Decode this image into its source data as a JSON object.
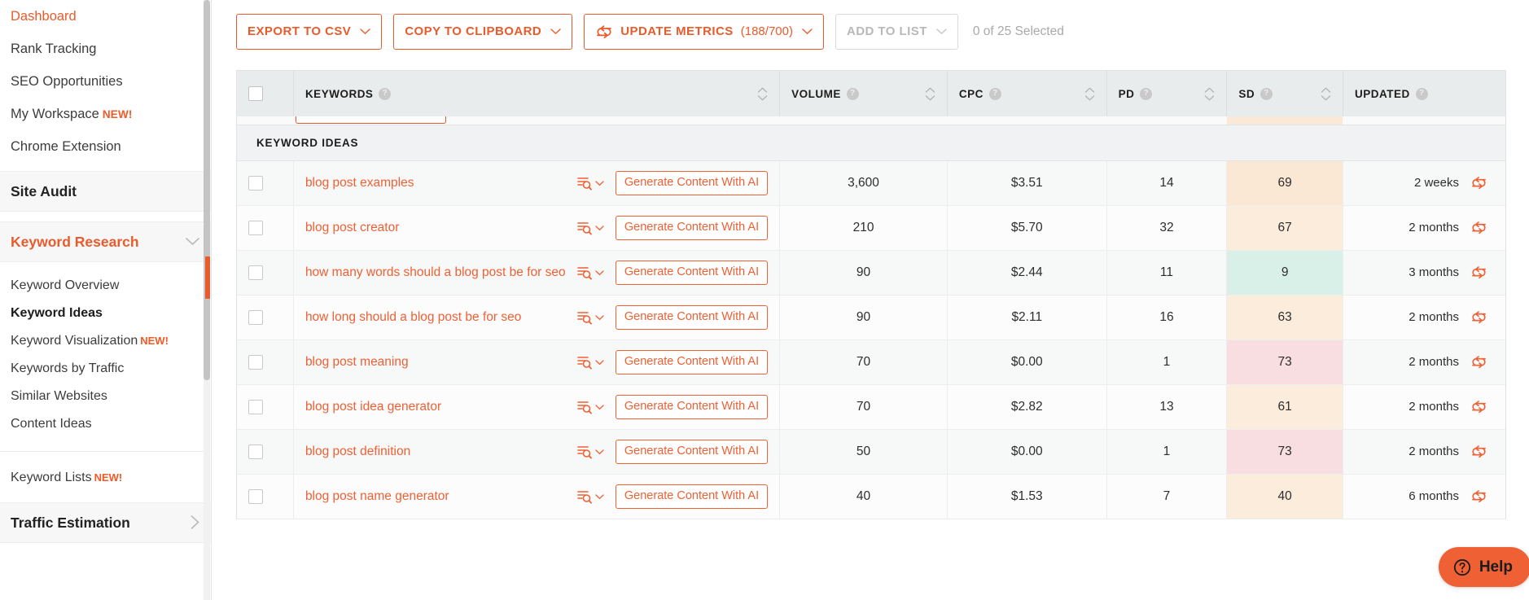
{
  "sidebar": {
    "top_items": [
      {
        "label": "Dashboard",
        "badge": ""
      },
      {
        "label": "Rank Tracking",
        "badge": ""
      },
      {
        "label": "SEO Opportunities",
        "badge": ""
      },
      {
        "label": "My Workspace",
        "badge": "NEW!"
      },
      {
        "label": "Chrome Extension",
        "badge": ""
      }
    ],
    "site_audit": {
      "label": "Site Audit",
      "chevron": "chevron-right-icon"
    },
    "keyword_research": {
      "label": "Keyword Research",
      "chevron": "chevron-down-icon"
    },
    "keyword_research_items": [
      {
        "label": "Keyword Overview",
        "badge": "",
        "selected": false
      },
      {
        "label": "Keyword Ideas",
        "badge": "",
        "selected": true
      },
      {
        "label": "Keyword Visualization",
        "badge": "NEW!",
        "selected": false
      },
      {
        "label": "Keywords by Traffic",
        "badge": "",
        "selected": false
      },
      {
        "label": "Similar Websites",
        "badge": "",
        "selected": false
      },
      {
        "label": "Content Ideas",
        "badge": "",
        "selected": false
      }
    ],
    "keyword_lists": {
      "label": "Keyword Lists",
      "badge": "NEW!"
    },
    "traffic_estimation": {
      "label": "Traffic Estimation",
      "chevron": "chevron-right-icon"
    },
    "accent_color": "#ea5b2c"
  },
  "toolbar": {
    "export_csv": "EXPORT TO CSV",
    "copy_clipboard": "COPY TO CLIPBOARD",
    "update_metrics": "UPDATE METRICS",
    "update_metrics_count": "(188/700)",
    "add_to_list": "ADD TO LIST",
    "selected_status": "0 of 25 Selected",
    "chevron": "chevron-down-icon",
    "sync_icon": "sync-icon"
  },
  "table": {
    "group_label": "KEYWORD IDEAS",
    "columns": [
      {
        "key": "checkbox",
        "label": "",
        "sortable": false,
        "help": false
      },
      {
        "key": "keywords",
        "label": "KEYWORDS",
        "sortable": true,
        "help": true
      },
      {
        "key": "volume",
        "label": "VOLUME",
        "sortable": true,
        "help": true
      },
      {
        "key": "cpc",
        "label": "CPC",
        "sortable": true,
        "help": true
      },
      {
        "key": "pd",
        "label": "PD",
        "sortable": true,
        "help": true
      },
      {
        "key": "sd",
        "label": "SD",
        "sortable": true,
        "help": true
      },
      {
        "key": "updated",
        "label": "UPDATED",
        "sortable": false,
        "help": true
      }
    ],
    "help_glyph": "?",
    "generate_button_label": "Generate Content With AI",
    "serp_icon": "serp-analysis-icon",
    "refresh_icon": "refresh-icon",
    "rows": [
      {
        "keyword": "blog post examples",
        "volume": "3,600",
        "cpc": "$3.51",
        "pd": "14",
        "sd": "69",
        "sd_color": "#fae8d4",
        "updated": "2 weeks"
      },
      {
        "keyword": "blog post creator",
        "volume": "210",
        "cpc": "$5.70",
        "pd": "32",
        "sd": "67",
        "sd_color": "#fbecdb",
        "updated": "2 months"
      },
      {
        "keyword": "how many words should a blog post be for seo",
        "volume": "90",
        "cpc": "$2.44",
        "pd": "11",
        "sd": "9",
        "sd_color": "#d8f0e8",
        "updated": "3 months"
      },
      {
        "keyword": "how long should a blog post be for seo",
        "volume": "90",
        "cpc": "$2.11",
        "pd": "16",
        "sd": "63",
        "sd_color": "#fbecdb",
        "updated": "2 months"
      },
      {
        "keyword": "blog post meaning",
        "volume": "70",
        "cpc": "$0.00",
        "pd": "1",
        "sd": "73",
        "sd_color": "#f8dee1",
        "updated": "2 months"
      },
      {
        "keyword": "blog post idea generator",
        "volume": "70",
        "cpc": "$2.82",
        "pd": "13",
        "sd": "61",
        "sd_color": "#fbecdb",
        "updated": "2 months"
      },
      {
        "keyword": "blog post definition",
        "volume": "50",
        "cpc": "$0.00",
        "pd": "1",
        "sd": "73",
        "sd_color": "#f8dee1",
        "updated": "2 months"
      },
      {
        "keyword": "blog post name generator",
        "volume": "40",
        "cpc": "$1.53",
        "pd": "7",
        "sd": "40",
        "sd_color": "#fbecdb",
        "updated": "6 months"
      }
    ]
  },
  "help_widget": {
    "label": "Help",
    "icon": "question-circle-icon",
    "color": "#ef6034"
  }
}
